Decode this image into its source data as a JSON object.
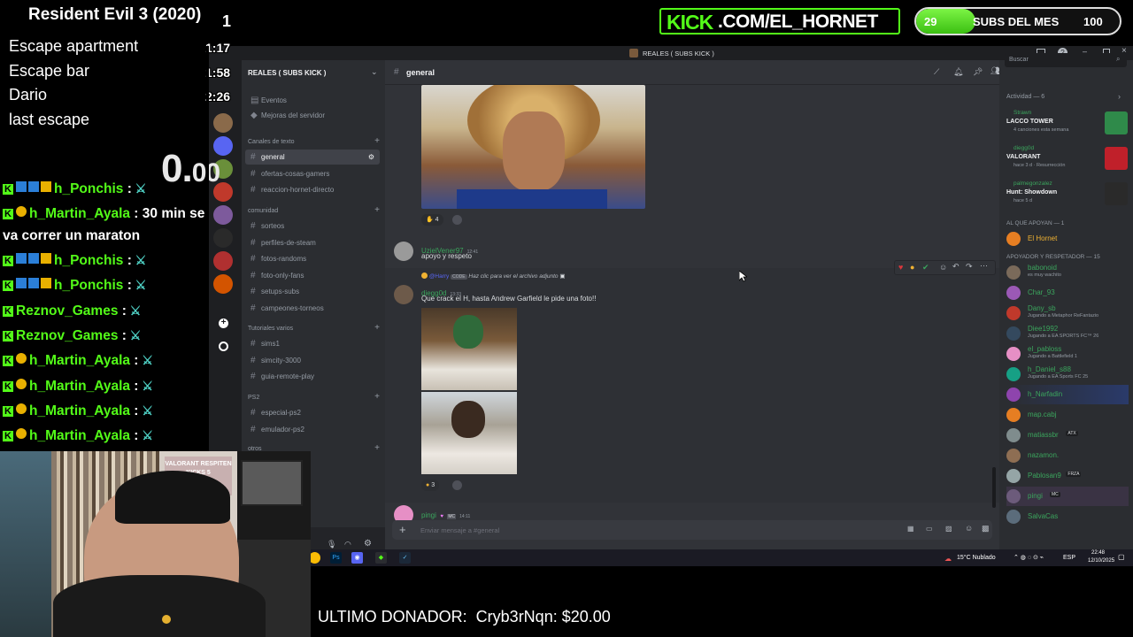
{
  "speedrun": {
    "game": "Resident Evil 3 (2020)",
    "attempts": "1",
    "splits": [
      {
        "name": "Escape apartment",
        "time": "1:17"
      },
      {
        "name": "Escape bar",
        "time": "1:58"
      },
      {
        "name": "Dario",
        "time": "2:26"
      },
      {
        "name": "last escape",
        "time": ""
      }
    ],
    "timer": "0.",
    "timer_decimal": "00"
  },
  "kick_banner": {
    "prefix": "KICK",
    "rest": ".COM/EL_HORNET"
  },
  "subs_goal": {
    "current": "29",
    "label": "SUBS DEL MES",
    "goal": "100",
    "progress": 0.29
  },
  "stream_chat": [
    {
      "user": "h_Ponchis",
      "sep": " :",
      "text": ""
    },
    {
      "user": "h_Martin_Ayala",
      "sep": " :",
      "text": " 30 min se"
    },
    {
      "user": "",
      "sep": "",
      "text": "va correr un maraton"
    },
    {
      "user": "h_Ponchis",
      "sep": " :",
      "text": ""
    },
    {
      "user": "h_Ponchis",
      "sep": " :",
      "text": ""
    },
    {
      "user": "Reznov_Games",
      "sep": " :",
      "text": ""
    },
    {
      "user": "Reznov_Games",
      "sep": " :",
      "text": ""
    },
    {
      "user": "h_Martin_Ayala",
      "sep": " :",
      "text": ""
    },
    {
      "user": "h_Martin_Ayala",
      "sep": " :",
      "text": ""
    },
    {
      "user": "h_Martin_Ayala",
      "sep": " :",
      "text": ""
    },
    {
      "user": "h_Martin_Ayala",
      "sep": " :",
      "text": ""
    }
  ],
  "donor": "ULTIMO DONADOR:  Cryb3rNqn: $20.00",
  "webcam_poster": "VALORANT RESPITEN KICKS 5",
  "discord": {
    "window_title": "REALES ( SUBS KICK )",
    "server_name": "REALES ( SUBS KICK )",
    "top_items": [
      "Eventos",
      "Mejoras del servidor"
    ],
    "categories": [
      {
        "name": "Canales de texto",
        "channels": [
          "general",
          "ofertas-cosas-gamers",
          "reaccion-hornet-directo"
        ]
      },
      {
        "name": "comunidad",
        "channels": [
          "sorteos",
          "perfiles-de-steam",
          "fotos-randoms",
          "foto-only-fans",
          "setups-subs",
          "campeones-torneos"
        ]
      },
      {
        "name": "Tutoriales varios",
        "channels": [
          "sims1",
          "simcity-3000",
          "guia-remote-play"
        ]
      },
      {
        "name": "PS2",
        "channels": [
          "especial-ps2",
          "emulador-ps2"
        ]
      },
      {
        "name": "otros",
        "channels": []
      }
    ],
    "current_channel": "general",
    "search_placeholder": "Buscar",
    "messages": [
      {
        "user": "UzielVener97",
        "time": "12:41",
        "text": "apoyo y respeto"
      },
      {
        "user": "diegg0d",
        "time": "13:33",
        "reply_user": "@Harry",
        "reply_tag": "CODE",
        "reply_text": "Haz clic para ver el archivo adjunto",
        "text": "Que crack el H, hasta Andrew Garfield le pide una foto!!"
      },
      {
        "user": "pingi",
        "time": "14:11",
        "tag": "MC",
        "text": ""
      }
    ],
    "reactions": {
      "first": "4",
      "second": "3"
    },
    "composer_placeholder": "Enviar mensaje a #general",
    "activity": {
      "header": "Actividad — 6",
      "items": [
        {
          "user": "Strawn",
          "title": "LACCO TOWER",
          "sub": "4 canciones esta semana"
        },
        {
          "user": "diegg0d",
          "title": "VALORANT",
          "sub": "hace 3 d · Resurrección"
        },
        {
          "user": "palmegonzalez",
          "title": "Hunt: Showdown",
          "sub": "hace 5 d"
        }
      ]
    },
    "member_groups": [
      {
        "name": "AL QUE APOYAN — 1",
        "members": [
          {
            "name": "El Hornet",
            "status": "",
            "color": "#f0b232"
          }
        ]
      },
      {
        "name": "APOYADOR Y RESPETADOR — 15",
        "members": [
          {
            "name": "babonoid",
            "status": "es muy wachito",
            "color": "#3ba55d"
          },
          {
            "name": "Char_93",
            "status": "",
            "color": "#3ba55d"
          },
          {
            "name": "Dany_sb",
            "status": "Jugando a Metaphor ReFantazio",
            "color": "#3ba55d"
          },
          {
            "name": "Diee1992",
            "status": "Jugando a EA SPORTS FC™ 26",
            "color": "#3ba55d"
          },
          {
            "name": "el_pabloss",
            "status": "Jugando a Battlefield 1",
            "color": "#3ba55d"
          },
          {
            "name": "h_Daniel_s88",
            "status": "Jugando a EA Sports FC 25",
            "color": "#3ba55d"
          },
          {
            "name": "h_Narfadin",
            "status": "",
            "color": "#3ba55d"
          },
          {
            "name": "map.cabj",
            "status": "",
            "color": "#3ba55d"
          },
          {
            "name": "matiassbr",
            "status": "",
            "tag": "ATX",
            "color": "#3ba55d"
          },
          {
            "name": "nazamon.",
            "status": "",
            "color": "#3ba55d"
          },
          {
            "name": "Pablosan9",
            "status": "",
            "tag": "FRZA",
            "color": "#3ba55d"
          },
          {
            "name": "pingi",
            "status": "",
            "tag": "MC",
            "color": "#3ba55d"
          },
          {
            "name": "SalvaCas",
            "status": "",
            "color": "#3ba55d"
          }
        ]
      }
    ]
  },
  "taskbar": {
    "weather": "15°C  Nublado",
    "lang": "ESP",
    "time": "22:48",
    "date": "12/10/2025"
  },
  "colors": {
    "kick_green": "#53fc18",
    "discord_bg": "#313338",
    "discord_sidebar": "#2b2d31",
    "discord_dark": "#1e1f22",
    "member_green": "#3ba55d"
  }
}
